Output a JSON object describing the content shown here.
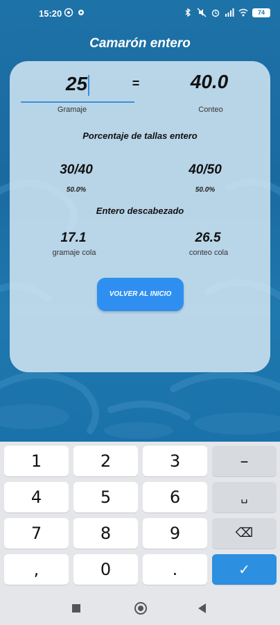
{
  "status_bar": {
    "time": "15:20",
    "battery": "74"
  },
  "app": {
    "title": "Camarón entero"
  },
  "conversion": {
    "gramaje_value": "25",
    "equals": "=",
    "conteo_value": "40.0",
    "gramaje_label": "Gramaje",
    "conteo_label": "Conteo"
  },
  "porcentaje": {
    "heading": "Porcentaje de tallas entero",
    "left_size": "30/40",
    "left_percent": "50.0%",
    "right_size": "40/50",
    "right_percent": "50.0%"
  },
  "descabezado": {
    "heading": "Entero descabezado",
    "gramaje_cola_value": "17.1",
    "gramaje_cola_label": "gramaje cola",
    "conteo_cola_value": "26.5",
    "conteo_cola_label": "conteo cola"
  },
  "home_button": {
    "label": "VOLVER AL INICIO"
  },
  "keyboard": {
    "keys": [
      "1",
      "2",
      "3",
      "–",
      "4",
      "5",
      "6",
      "␣",
      "7",
      "8",
      "9",
      "⌫",
      ",",
      "0",
      ".",
      "✓"
    ]
  },
  "colors": {
    "accent": "#2f8ff0",
    "background": "#1d72a8",
    "card": "#dcecf6"
  }
}
